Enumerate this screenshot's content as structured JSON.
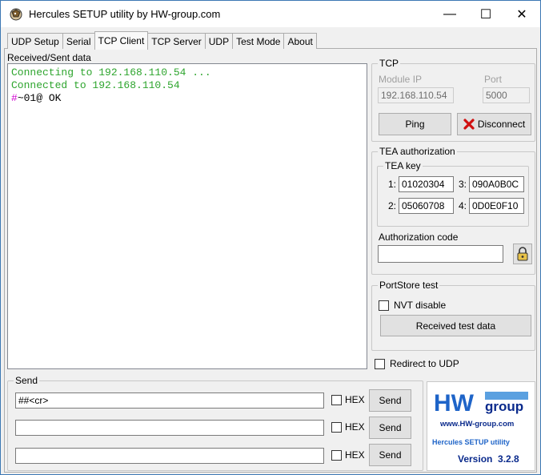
{
  "window": {
    "title": "Hercules SETUP utility by HW-group.com",
    "minimize": "—",
    "maximize": "☐",
    "close": "✕"
  },
  "tabs": [
    "UDP Setup",
    "Serial",
    "TCP Client",
    "TCP Server",
    "UDP",
    "Test Mode",
    "About"
  ],
  "active_tab": "TCP Client",
  "received": {
    "label": "Received/Sent data",
    "lines": [
      {
        "text": "Connecting to 192.168.110.54 ...",
        "color": "#2ea52e"
      },
      {
        "text": "Connected to 192.168.110.54",
        "color": "#2ea52e"
      },
      {
        "prefix": "#",
        "text": "~01@ OK",
        "prefix_color": "#d000d0"
      }
    ]
  },
  "tcp": {
    "title": "TCP",
    "module_ip_label": "Module IP",
    "port_label": "Port",
    "module_ip": "192.168.110.54",
    "port": "5000",
    "ping_label": "Ping",
    "disconnect_label": "Disconnect"
  },
  "tea": {
    "title": "TEA authorization",
    "key_title": "TEA key",
    "k1_label": "1:",
    "k1": "01020304",
    "k2_label": "2:",
    "k2": "05060708",
    "k3_label": "3:",
    "k3": "090A0B0C",
    "k4_label": "4:",
    "k4": "0D0E0F10",
    "auth_label": "Authorization code",
    "auth_value": ""
  },
  "portstore": {
    "title": "PortStore test",
    "nvt_label": "NVT disable",
    "received_test_label": "Received test data"
  },
  "redirect_label": "Redirect to UDP",
  "send": {
    "title": "Send",
    "rows": [
      {
        "value": "##<cr>",
        "hex_label": "HEX",
        "send_label": "Send"
      },
      {
        "value": "",
        "hex_label": "HEX",
        "send_label": "Send"
      },
      {
        "value": "",
        "hex_label": "HEX",
        "send_label": "Send"
      }
    ]
  },
  "logo": {
    "hw": "HW",
    "group": "group",
    "url": "www.HW-group.com",
    "product": "Hercules SETUP utility",
    "version": "Version  3.2.8"
  },
  "colors": {
    "accent_blue": "#2c78c8",
    "dark_blue": "#0a2a8c",
    "text_green": "#2ea52e"
  }
}
